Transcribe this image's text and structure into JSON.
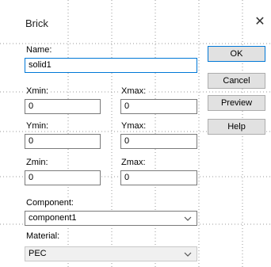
{
  "dialog": {
    "title": "Brick",
    "close_glyph": "✕"
  },
  "form": {
    "name_label": "Name:",
    "name_value": "solid1",
    "xmin_label": "Xmin:",
    "xmin_value": "0",
    "xmax_label": "Xmax:",
    "xmax_value": "0",
    "ymin_label": "Ymin:",
    "ymin_value": "0",
    "ymax_label": "Ymax:",
    "ymax_value": "0",
    "zmin_label": "Zmin:",
    "zmin_value": "0",
    "zmax_label": "Zmax:",
    "zmax_value": "0",
    "component_label": "Component:",
    "component_value": "component1",
    "material_label": "Material:",
    "material_value": "PEC"
  },
  "buttons": {
    "ok": "OK",
    "cancel": "Cancel",
    "preview": "Preview",
    "help": "Help"
  },
  "colors": {
    "focus_border": "#0078d7",
    "button_face": "#e1e1e1"
  }
}
